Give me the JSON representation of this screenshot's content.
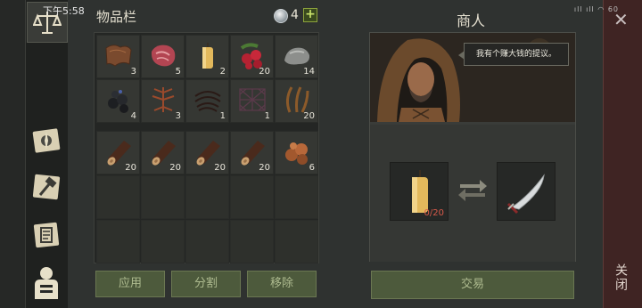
{
  "status": {
    "time": "下午5:58",
    "right": "ıll ıll ◠ 60"
  },
  "inventory": {
    "title": "物品栏",
    "currency": {
      "icon": "coin-icon",
      "amount": "4",
      "add": "+"
    },
    "slots": [
      {
        "icon": "leather-icon",
        "qty": "3"
      },
      {
        "icon": "raw-meat-icon",
        "qty": "5"
      },
      {
        "icon": "candle-icon",
        "qty": "2"
      },
      {
        "icon": "berries-icon",
        "qty": "20"
      },
      {
        "icon": "stone-icon",
        "qty": "14"
      },
      {
        "icon": "coal-icon",
        "qty": "4"
      },
      {
        "icon": "herb-root-icon",
        "qty": "3"
      },
      {
        "icon": "rope-icon",
        "qty": "1"
      },
      {
        "icon": "net-icon",
        "qty": "1"
      },
      {
        "icon": "plant-fiber-icon",
        "qty": "20"
      },
      {
        "icon": "log-icon",
        "qty": "20"
      },
      {
        "icon": "log-icon",
        "qty": "20"
      },
      {
        "icon": "log-icon",
        "qty": "20"
      },
      {
        "icon": "log-icon",
        "qty": "20"
      },
      {
        "icon": "copper-ore-icon",
        "qty": "6"
      }
    ],
    "buttons": {
      "apply": "应用",
      "split": "分割",
      "remove": "移除"
    }
  },
  "merchant": {
    "title": "商人",
    "speech": "我有个赚大钱的提议。",
    "offer_item": {
      "icon": "candle-icon",
      "qty": "0/20"
    },
    "reward_item": {
      "icon": "sabre-icon"
    },
    "trade_button": "交易"
  },
  "close": {
    "x": "✕",
    "label": "关闭"
  },
  "nav": [
    "scales-icon",
    "map-compass-icon",
    "crafting-hammer-icon",
    "scroll-icon",
    "character-icon"
  ]
}
